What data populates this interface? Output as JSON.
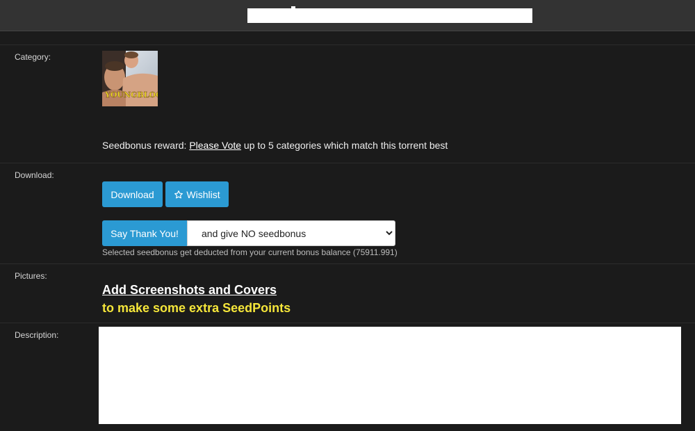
{
  "header": {
    "title": ""
  },
  "category": {
    "label": "Category:",
    "thumbnail_caption": "YOUNGBLOOD",
    "seedbonus_prefix": "Seedbonus reward: ",
    "vote_link": "Please Vote",
    "seedbonus_suffix": " up to 5 categories which match this torrent best"
  },
  "download": {
    "label": "Download:",
    "download_button": "Download",
    "wishlist_button": "Wishlist",
    "thank_button": "Say Thank You!",
    "seedbonus_select_value": "and give NO seedbonus",
    "balance_note": "Selected seedbonus get deducted from your current bonus balance (75911.991)"
  },
  "pictures": {
    "label": "Pictures:",
    "add_link": "Add Screenshots and Covers",
    "extra_text": "to make some extra SeedPoints"
  },
  "description": {
    "label": "Description:"
  },
  "icons": {
    "wishlist": "star-outline-icon",
    "select": "chevron-down-icon"
  },
  "colors": {
    "background": "#1b1b1b",
    "header": "#333333",
    "button": "#2b9ad3",
    "highlight": "#f5e63a"
  }
}
